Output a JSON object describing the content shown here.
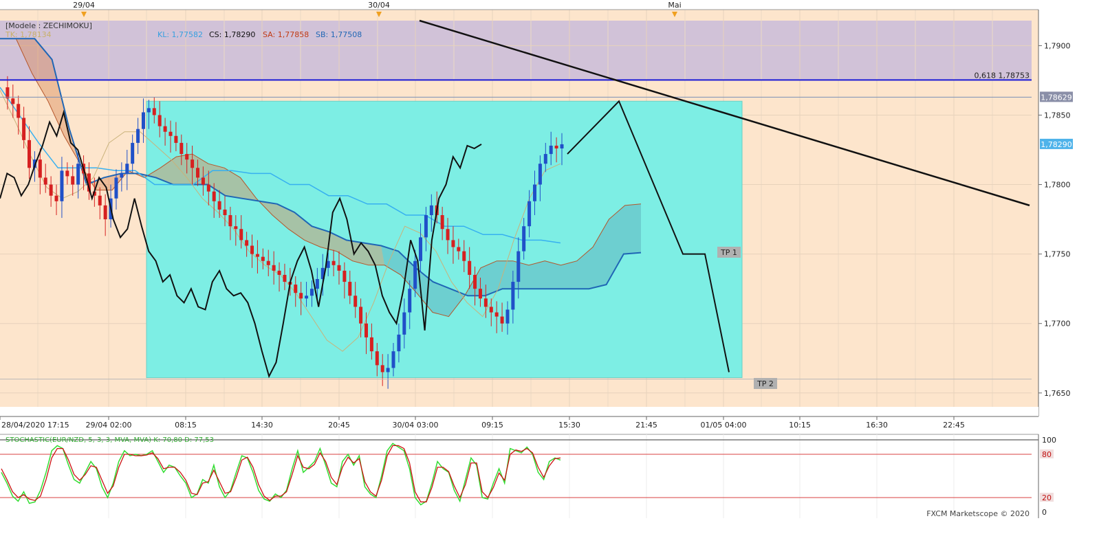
{
  "top_axis": {
    "labels": [
      "29/04",
      "30/04",
      "Mai"
    ]
  },
  "legend": {
    "model": "[Modele : ZECHIMOKU]",
    "tk": "TK: 1,78134",
    "kl": "KL: 1,77582",
    "cs": "CS: 1,78290",
    "sa": "SA: 1,77858",
    "sb": "SB: 1,77508"
  },
  "fib": {
    "label": "0,618 1,78753"
  },
  "price_tags": {
    "level": "1,78629",
    "current": "1,78290"
  },
  "targets": {
    "tp1": "TP 1",
    "tp2": "TP 2"
  },
  "osc_legend": "STOCHASTIC(EUR/NZD, 5, 3, 3, MVA, MVA)  K: 70,80  D: 77,53",
  "footer": "FXCM Marketscope © 2020",
  "chart_data": [
    {
      "type": "candlestick",
      "ylim": [
        1.764,
        1.7918
      ],
      "y_ticks": [
        1.765,
        1.77,
        1.775,
        1.78,
        1.785,
        1.79
      ],
      "y_tick_labels": [
        "1,7650",
        "1,7700",
        "1,7750",
        "1,7800",
        "1,7850",
        "1,7900"
      ],
      "x_labels": [
        "28/04/2020 17:15",
        "29/04 02:00",
        "08:15",
        "14:30",
        "20:45",
        "30/04 03:00",
        "09:15",
        "15:30",
        "21:45",
        "01/05 04:00",
        "10:15",
        "16:30",
        "22:45"
      ],
      "close_path": [
        1.787,
        1.7862,
        1.7858,
        1.7848,
        1.7832,
        1.7812,
        1.7818,
        1.7805,
        1.78,
        1.7792,
        1.7788,
        1.781,
        1.7806,
        1.78,
        1.7815,
        1.7808,
        1.7795,
        1.7792,
        1.7785,
        1.7775,
        1.779,
        1.7805,
        1.7808,
        1.7815,
        1.783,
        1.784,
        1.7852,
        1.7855,
        1.785,
        1.7842,
        1.7838,
        1.7835,
        1.783,
        1.7822,
        1.7818,
        1.7812,
        1.7805,
        1.78,
        1.7795,
        1.7788,
        1.7782,
        1.7778,
        1.777,
        1.7768,
        1.776,
        1.7756,
        1.775,
        1.7748,
        1.7745,
        1.7742,
        1.7738,
        1.7735,
        1.773,
        1.7728,
        1.7722,
        1.7718,
        1.772,
        1.7725,
        1.7732,
        1.774,
        1.7745,
        1.7742,
        1.7738,
        1.773,
        1.772,
        1.7712,
        1.77,
        1.769,
        1.768,
        1.767,
        1.7665,
        1.7668,
        1.768,
        1.7692,
        1.7708,
        1.7725,
        1.7745,
        1.7762,
        1.7778,
        1.7785,
        1.7778,
        1.7768,
        1.776,
        1.7755,
        1.7752,
        1.7745,
        1.7735,
        1.7725,
        1.7718,
        1.7712,
        1.7708,
        1.7705,
        1.77,
        1.771,
        1.773,
        1.7752,
        1.777,
        1.7788,
        1.78,
        1.7815,
        1.7822,
        1.7828,
        1.7826,
        1.7829
      ],
      "chikou_path": [
        1.779,
        1.7808,
        1.7805,
        1.7792,
        1.78,
        1.7815,
        1.7828,
        1.7845,
        1.7835,
        1.7852,
        1.783,
        1.7825,
        1.7808,
        1.779,
        1.7805,
        1.7798,
        1.7775,
        1.7762,
        1.7768,
        1.779,
        1.777,
        1.7752,
        1.7745,
        1.773,
        1.7735,
        1.772,
        1.7715,
        1.7725,
        1.7712,
        1.771,
        1.773,
        1.7738,
        1.7725,
        1.772,
        1.7722,
        1.7715,
        1.77,
        1.768,
        1.7662,
        1.7672,
        1.77,
        1.773,
        1.7745,
        1.7755,
        1.7738,
        1.7712,
        1.774,
        1.778,
        1.779,
        1.7775,
        1.775,
        1.7758,
        1.7752,
        1.7742,
        1.772,
        1.7708,
        1.77,
        1.7725,
        1.776,
        1.7745,
        1.7695,
        1.776,
        1.779,
        1.78,
        1.782,
        1.7812,
        1.7828,
        1.7826,
        1.7829
      ],
      "kijun_path": [
        1.787,
        1.785,
        1.783,
        1.7812,
        1.7812,
        1.7812,
        1.781,
        1.781,
        1.78,
        1.78,
        1.78,
        1.781,
        1.781,
        1.7808,
        1.7808,
        1.78,
        1.78,
        1.7792,
        1.7792,
        1.7786,
        1.7786,
        1.7778,
        1.7778,
        1.777,
        1.777,
        1.7764,
        1.7764,
        1.776,
        1.776,
        1.7758
      ],
      "tenkan_path": [
        1.7868,
        1.7845,
        1.782,
        1.7798,
        1.779,
        1.7795,
        1.7805,
        1.783,
        1.7838,
        1.7838,
        1.7828,
        1.7818,
        1.7805,
        1.779,
        1.778,
        1.7768,
        1.7752,
        1.7742,
        1.7735,
        1.7722,
        1.7705,
        1.7688,
        1.768,
        1.769,
        1.7715,
        1.7745,
        1.777,
        1.7765,
        1.7752,
        1.773,
        1.7715,
        1.7705,
        1.7725,
        1.776,
        1.779,
        1.781,
        1.7815
      ],
      "senkou_a_path": [
        1.7905,
        1.7905,
        1.788,
        1.786,
        1.7835,
        1.7815,
        1.7796,
        1.7796,
        1.781,
        1.7805,
        1.7812,
        1.782,
        1.7822,
        1.7815,
        1.7812,
        1.7805,
        1.779,
        1.7778,
        1.7768,
        1.776,
        1.7755,
        1.7752,
        1.7745,
        1.7742,
        1.7742,
        1.7735,
        1.7722,
        1.7708,
        1.7705,
        1.772,
        1.774,
        1.7745,
        1.7745,
        1.7742,
        1.7745,
        1.7742,
        1.7745,
        1.7755,
        1.7775,
        1.7785,
        1.7786
      ],
      "senkou_b_path": [
        1.7905,
        1.7905,
        1.7905,
        1.789,
        1.784,
        1.78,
        1.7805,
        1.7808,
        1.7808,
        1.7805,
        1.78,
        1.78,
        1.78,
        1.7792,
        1.779,
        1.7788,
        1.7786,
        1.778,
        1.777,
        1.7766,
        1.776,
        1.7758,
        1.7756,
        1.7752,
        1.774,
        1.773,
        1.7725,
        1.772,
        1.772,
        1.7725,
        1.7725,
        1.7725,
        1.7725,
        1.7725,
        1.7725,
        1.7728,
        1.775,
        1.7751
      ],
      "fib_0618": 1.78753,
      "resistance": 1.78629,
      "current_price": 1.7829,
      "projection_path": [
        1.7822,
        1.786,
        1.775,
        1.775,
        1.7665
      ],
      "trendline": [
        1.7918,
        1.7785
      ],
      "target_box": [
        1.786,
        1.7661
      ]
    },
    {
      "type": "line",
      "ylim": [
        0,
        100
      ],
      "y_ticks": [
        0,
        20,
        80,
        100
      ],
      "y_tick_labels": [
        "0",
        "20",
        "80",
        "100"
      ],
      "series": [
        {
          "name": "K",
          "values": [
            55,
            40,
            22,
            15,
            28,
            12,
            14,
            30,
            55,
            85,
            92,
            88,
            65,
            45,
            40,
            55,
            70,
            60,
            35,
            20,
            40,
            70,
            85,
            78,
            80,
            78,
            80,
            85,
            70,
            55,
            65,
            62,
            50,
            40,
            20,
            25,
            45,
            40,
            65,
            35,
            20,
            30,
            55,
            78,
            75,
            55,
            30,
            18,
            15,
            25,
            20,
            30,
            60,
            85,
            55,
            62,
            70,
            88,
            65,
            40,
            35,
            70,
            80,
            65,
            78,
            35,
            25,
            20,
            50,
            85,
            95,
            90,
            85,
            60,
            20,
            10,
            15,
            40,
            70,
            60,
            55,
            30,
            15,
            45,
            75,
            65,
            20,
            18,
            40,
            60,
            40,
            88,
            85,
            82,
            90,
            80,
            55,
            45,
            70,
            75,
            72
          ]
        },
        {
          "name": "D",
          "values": [
            60,
            45,
            28,
            20,
            24,
            18,
            16,
            22,
            45,
            75,
            88,
            88,
            72,
            52,
            44,
            52,
            64,
            62,
            44,
            26,
            36,
            62,
            80,
            80,
            78,
            78,
            79,
            82,
            74,
            60,
            62,
            62,
            55,
            44,
            26,
            24,
            40,
            42,
            58,
            42,
            26,
            28,
            48,
            72,
            76,
            62,
            38,
            22,
            16,
            22,
            22,
            28,
            52,
            78,
            62,
            60,
            66,
            82,
            70,
            48,
            38,
            62,
            76,
            68,
            74,
            42,
            28,
            22,
            44,
            78,
            92,
            92,
            88,
            68,
            28,
            14,
            14,
            34,
            62,
            62,
            56,
            36,
            20,
            38,
            68,
            68,
            28,
            20,
            34,
            54,
            44,
            80,
            86,
            84,
            88,
            82,
            62,
            48,
            64,
            74,
            75
          ]
        }
      ]
    }
  ]
}
